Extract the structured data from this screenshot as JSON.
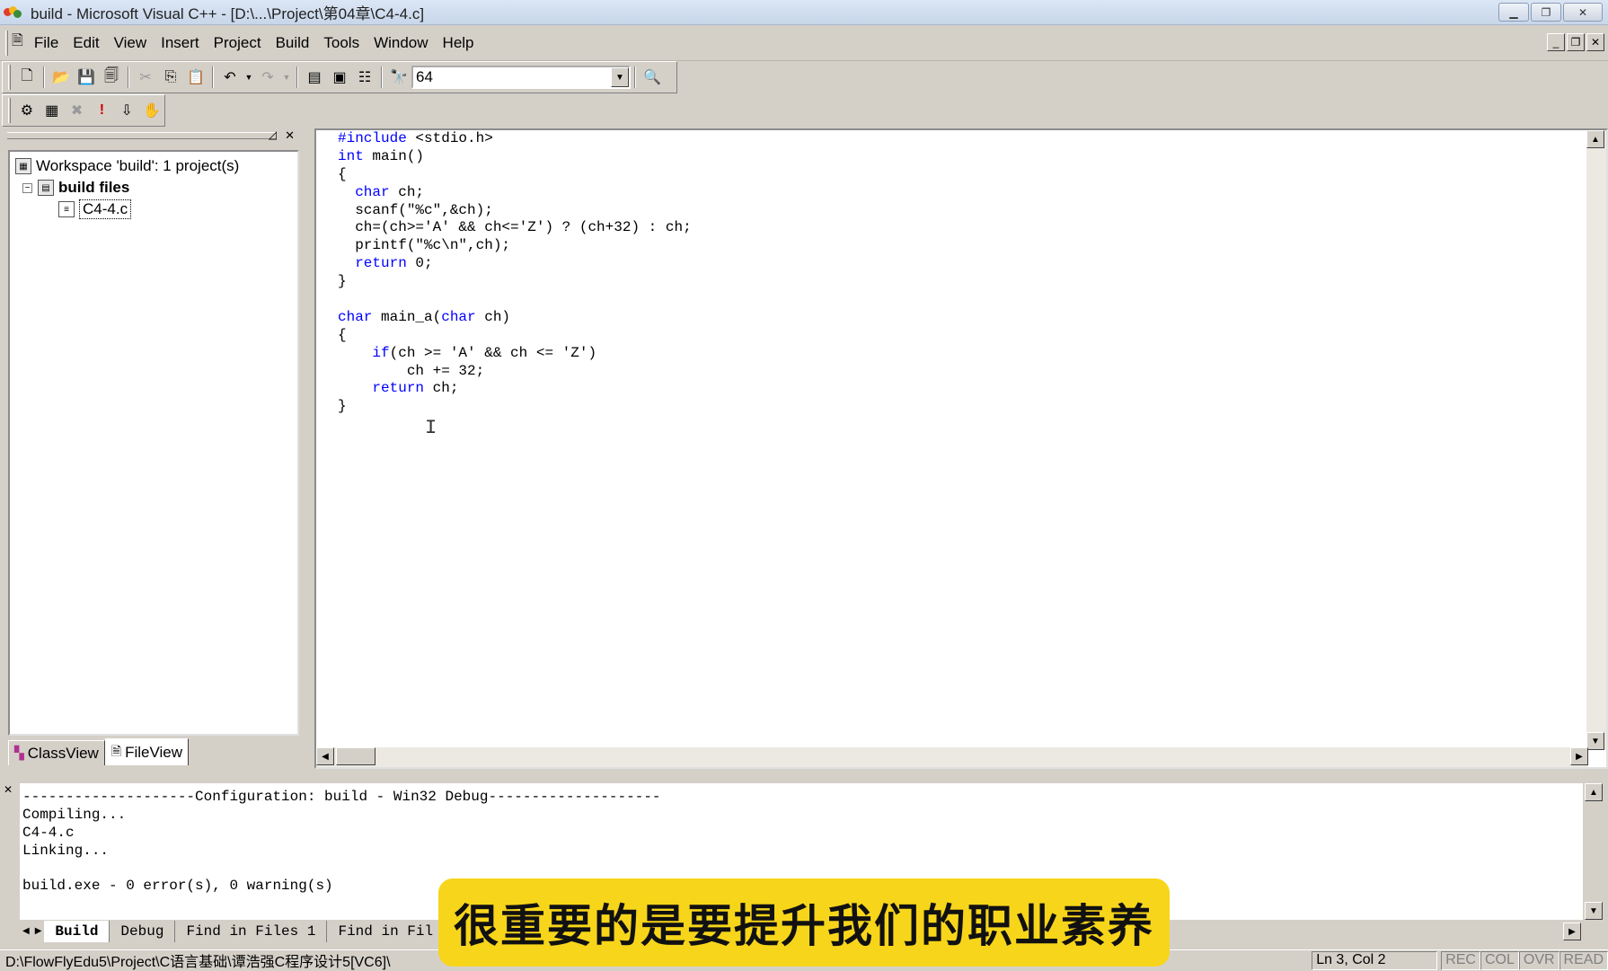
{
  "window": {
    "title": "build - Microsoft Visual C++ - [D:\\...\\Project\\第04章\\C4-4.c]"
  },
  "menu": {
    "items": [
      "File",
      "Edit",
      "View",
      "Insert",
      "Project",
      "Build",
      "Tools",
      "Window",
      "Help"
    ]
  },
  "toolbar": {
    "find_combo_value": "64"
  },
  "workspace": {
    "root": "Workspace 'build': 1 project(s)",
    "project": "build files",
    "file": "C4-4.c",
    "tabs": [
      "ClassView",
      "FileView"
    ]
  },
  "editor": {
    "lines": [
      [
        {
          "t": "#include",
          "k": 1
        },
        {
          "t": " <stdio.h>",
          "k": 0
        }
      ],
      [
        {
          "t": "int",
          "k": 1
        },
        {
          "t": " main()",
          "k": 0
        }
      ],
      [
        {
          "t": "{",
          "k": 0
        }
      ],
      [
        {
          "t": "  ",
          "k": 0
        },
        {
          "t": "char",
          "k": 1
        },
        {
          "t": " ch;",
          "k": 0
        }
      ],
      [
        {
          "t": "  scanf(\"%c\",&ch);",
          "k": 0
        }
      ],
      [
        {
          "t": "  ch=(ch>='A' && ch<='Z') ? (ch+32) : ch;",
          "k": 0
        }
      ],
      [
        {
          "t": "  printf(\"%c\\n\",ch);",
          "k": 0
        }
      ],
      [
        {
          "t": "  ",
          "k": 0
        },
        {
          "t": "return",
          "k": 1
        },
        {
          "t": " 0;",
          "k": 0
        }
      ],
      [
        {
          "t": "}",
          "k": 0
        }
      ],
      [
        {
          "t": "",
          "k": 0
        }
      ],
      [
        {
          "t": "char",
          "k": 1
        },
        {
          "t": " main_a(",
          "k": 0
        },
        {
          "t": "char",
          "k": 1
        },
        {
          "t": " ch)",
          "k": 0
        }
      ],
      [
        {
          "t": "{",
          "k": 0
        }
      ],
      [
        {
          "t": "    ",
          "k": 0
        },
        {
          "t": "if",
          "k": 1
        },
        {
          "t": "(ch >= 'A' && ch <= 'Z')",
          "k": 0
        }
      ],
      [
        {
          "t": "        ch += 32;",
          "k": 0
        }
      ],
      [
        {
          "t": "    ",
          "k": 0
        },
        {
          "t": "return",
          "k": 1
        },
        {
          "t": " ch;",
          "k": 0
        }
      ],
      [
        {
          "t": "}",
          "k": 0
        }
      ]
    ]
  },
  "output": {
    "lines": [
      "--------------------Configuration: build - Win32 Debug--------------------",
      "Compiling...",
      "C4-4.c",
      "Linking...",
      "",
      "build.exe - 0 error(s), 0 warning(s)"
    ],
    "tabs": [
      "Build",
      "Debug",
      "Find in Files 1",
      "Find in Fil"
    ]
  },
  "status": {
    "path": "D:\\FlowFlyEdu5\\Project\\C语言基础\\谭浩强C程序设计5[VC6]\\",
    "position": "Ln 3, Col 2",
    "indicators": [
      "REC",
      "COL",
      "OVR",
      "READ"
    ]
  },
  "subtitle": "很重要的是要提升我们的职业素养",
  "colors": {
    "keyword": "#0000ff",
    "subtitle_bg": "#f7d51a"
  }
}
